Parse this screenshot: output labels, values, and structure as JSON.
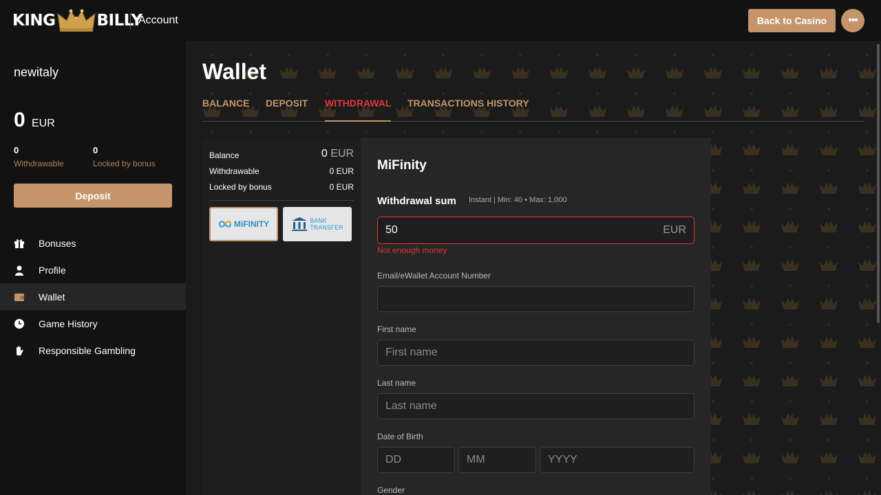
{
  "header": {
    "logo_left": "KING",
    "logo_right": "BILLY",
    "title": "Account",
    "back_label": "Back to Casino",
    "more_label": "•••"
  },
  "sidebar": {
    "username": "newitaly",
    "balance": "0",
    "currency": "EUR",
    "withdrawable_value": "0",
    "withdrawable_label": "Withdrawable",
    "locked_value": "0",
    "locked_label": "Locked by bonus",
    "deposit_label": "Deposit",
    "items": [
      {
        "label": "Bonuses",
        "icon": "gift-icon"
      },
      {
        "label": "Profile",
        "icon": "user-icon"
      },
      {
        "label": "Wallet",
        "icon": "wallet-icon",
        "active": true
      },
      {
        "label": "Game History",
        "icon": "clock-icon"
      },
      {
        "label": "Responsible Gambling",
        "icon": "hand-icon"
      }
    ]
  },
  "main": {
    "title": "Wallet",
    "tabs": [
      {
        "label": "BALANCE"
      },
      {
        "label": "DEPOSIT"
      },
      {
        "label": "WITHDRAWAL",
        "active": true
      },
      {
        "label": "TRANSACTIONS HISTORY"
      }
    ]
  },
  "summary": {
    "balance_label": "Balance",
    "balance_value": "0",
    "balance_currency": "EUR",
    "withdrawable_label": "Withdrawable",
    "withdrawable_value": "0 EUR",
    "locked_label": "Locked by bonus",
    "locked_value": "0 EUR"
  },
  "methods": [
    {
      "name": "MiFINITY",
      "selected": true
    },
    {
      "name_line1": "BANK",
      "name_line2": "TRANSFER",
      "selected": false
    }
  ],
  "form": {
    "title": "MiFinity",
    "sum_label": "Withdrawal sum",
    "sum_hint": "Instant | Min: 40 • Max: 1,000",
    "sum_value": "50",
    "sum_currency": "EUR",
    "error": "Not enough money",
    "account_label": "Email/eWallet Account Number",
    "account_value": "",
    "first_name_label": "First name",
    "first_name_placeholder": "First name",
    "last_name_label": "Last name",
    "last_name_placeholder": "Last name",
    "dob_label": "Date of Birth",
    "dob_dd_placeholder": "DD",
    "dob_mm_placeholder": "MM",
    "dob_yyyy_placeholder": "YYYY",
    "gender_label": "Gender"
  },
  "colors": {
    "accent": "#c4956a",
    "error": "#e0353d",
    "background": "#121212"
  }
}
